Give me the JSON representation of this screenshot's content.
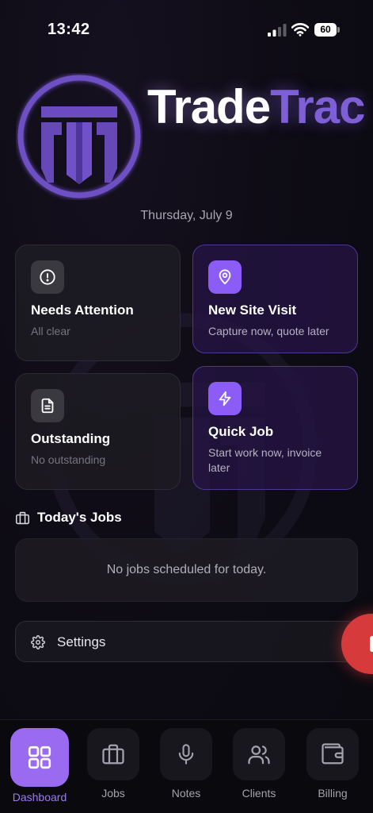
{
  "status_bar": {
    "time": "13:42",
    "battery": "60"
  },
  "brand": {
    "part1": "Trade",
    "part2": "Trac"
  },
  "date": "Thursday, July 9",
  "cards": {
    "needs_attention": {
      "title": "Needs Attention",
      "subtitle": "All clear",
      "icon": "alert-circle-icon"
    },
    "new_site_visit": {
      "title": "New Site Visit",
      "subtitle": "Capture now, quote later",
      "icon": "map-pin-icon"
    },
    "outstanding": {
      "title": "Outstanding",
      "subtitle": "No outstanding",
      "icon": "document-icon"
    },
    "quick_job": {
      "title": "Quick Job",
      "subtitle": "Start work now, invoice later",
      "icon": "lightning-icon"
    }
  },
  "today_jobs": {
    "heading": "Today's Jobs",
    "empty_text": "No jobs scheduled for today."
  },
  "settings": {
    "label": "Settings"
  },
  "nav": {
    "items": [
      {
        "label": "Dashboard",
        "icon": "grid-icon",
        "active": true
      },
      {
        "label": "Jobs",
        "icon": "briefcase-icon",
        "active": false
      },
      {
        "label": "Notes",
        "icon": "microphone-icon",
        "active": false
      },
      {
        "label": "Clients",
        "icon": "users-icon",
        "active": false
      },
      {
        "label": "Billing",
        "icon": "wallet-icon",
        "active": false
      }
    ]
  },
  "colors": {
    "accent": "#8b5cf6",
    "accent_text": "#9d7af2",
    "brand_purple": "#7f5fd6",
    "background": "#0d0b14",
    "fab": "#d63a3a"
  }
}
